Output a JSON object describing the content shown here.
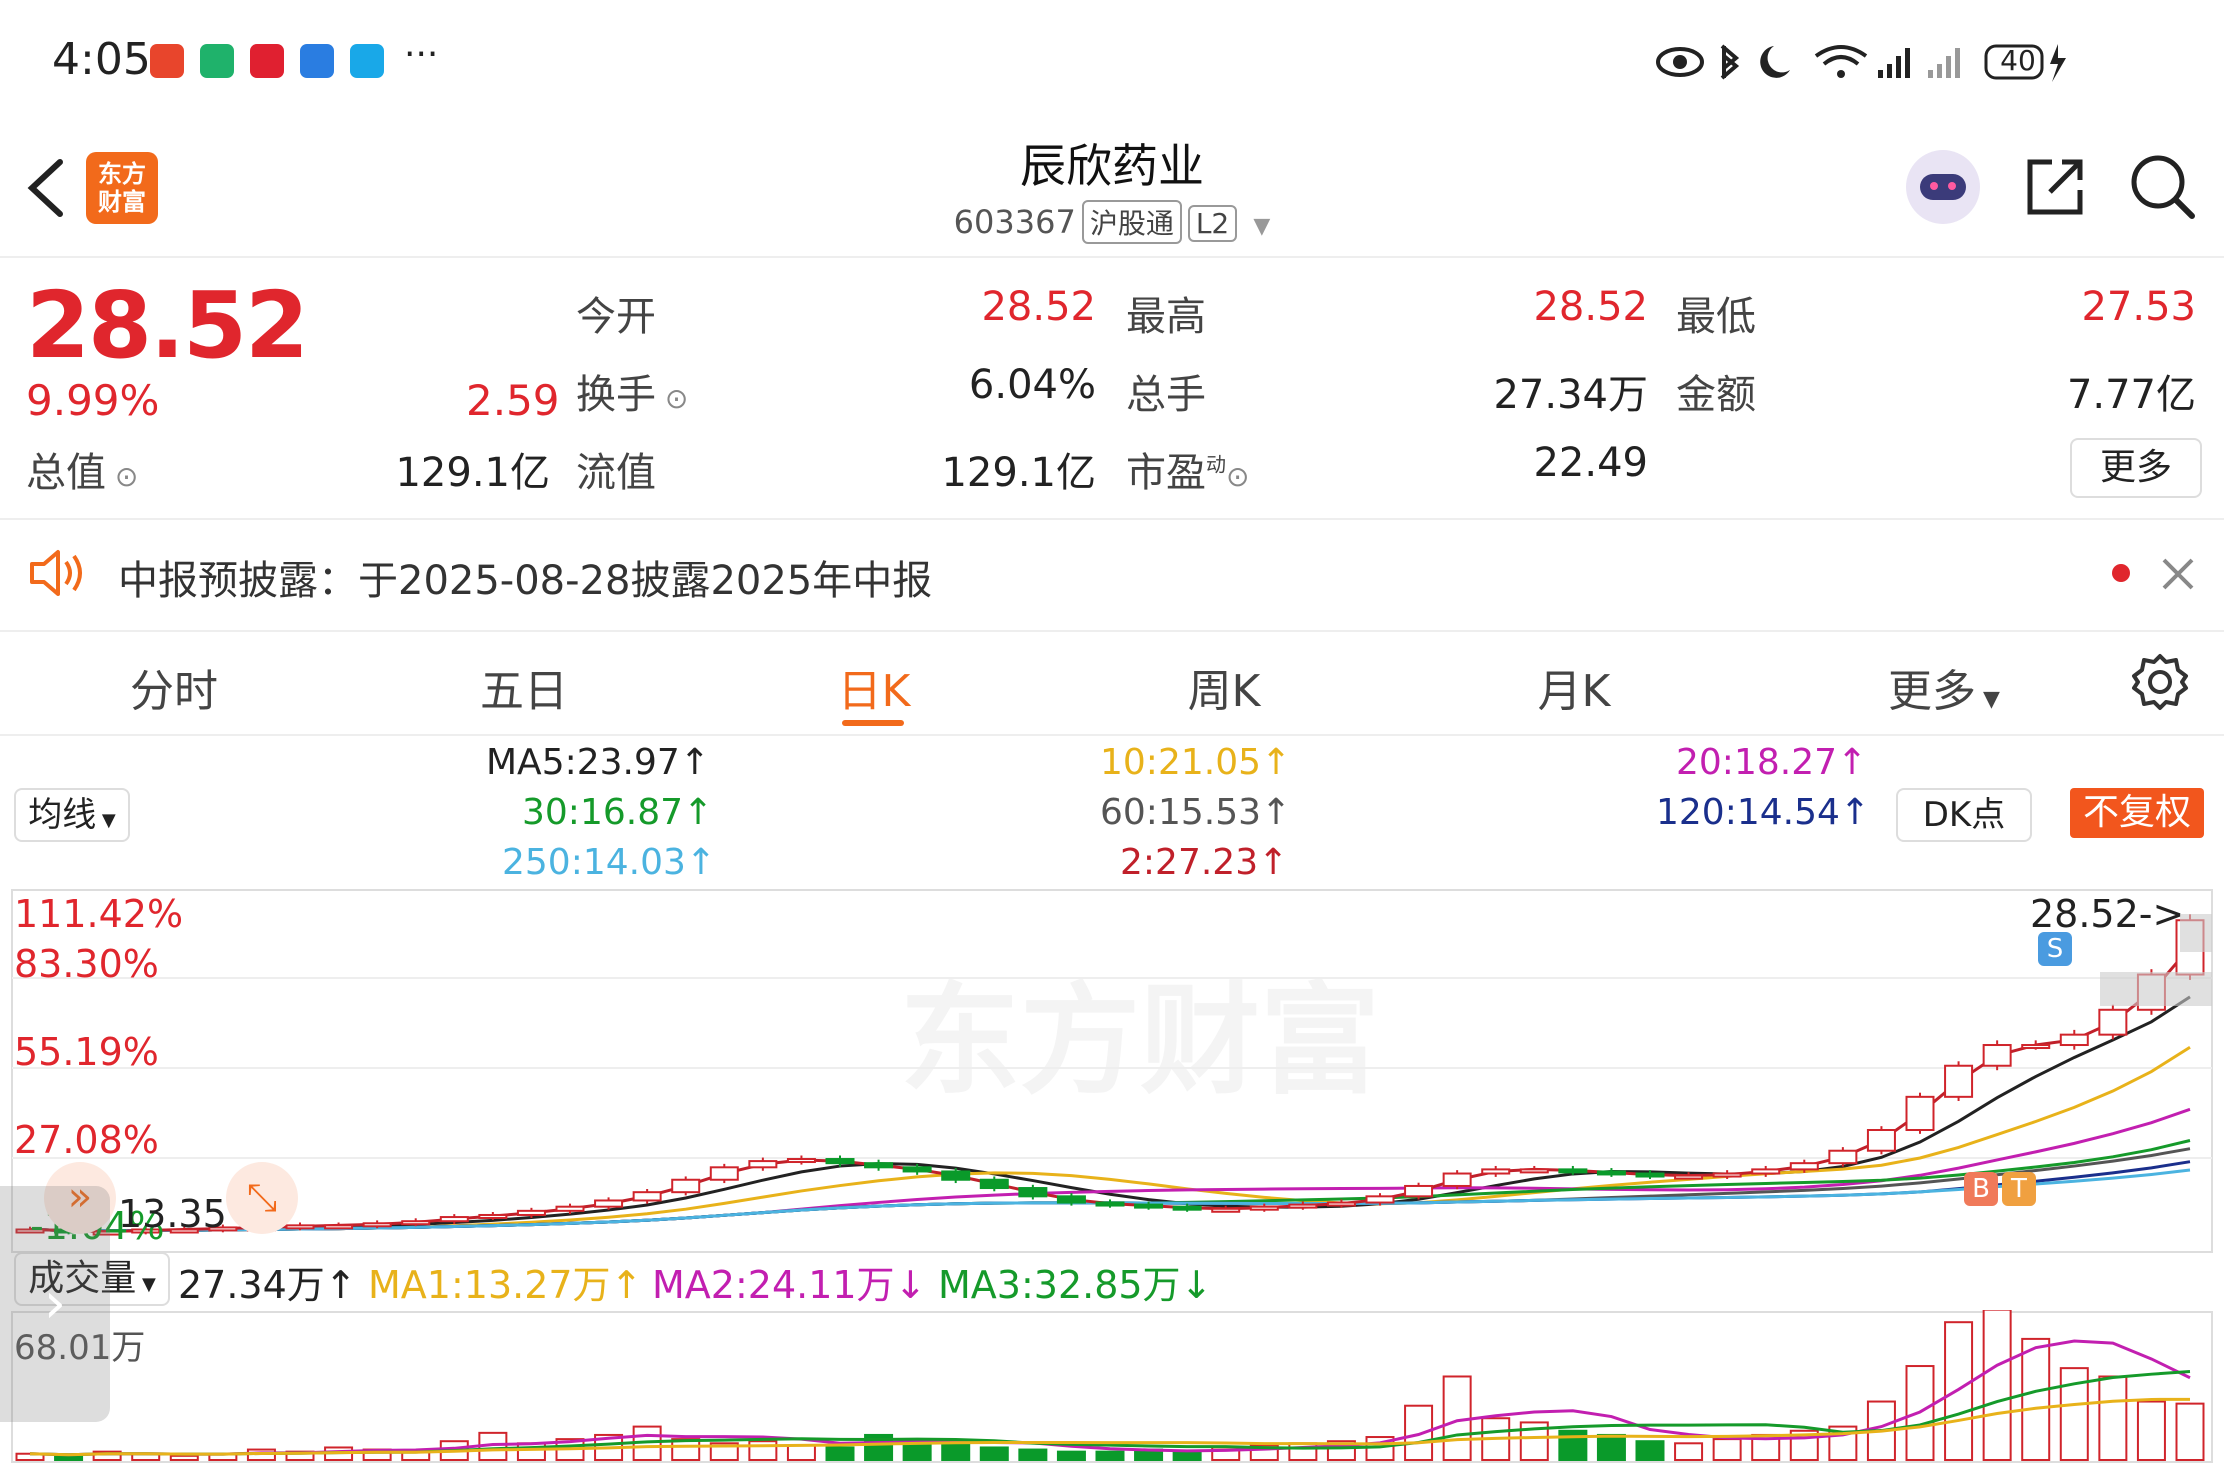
{
  "status_bar": {
    "time": "4:05",
    "ellipsis": "···",
    "battery": "40",
    "app_colors": [
      "#e8452c",
      "#1fb26b",
      "#e02030",
      "#2a7de1",
      "#19a8e8"
    ]
  },
  "header": {
    "logo_line1": "东方",
    "logo_line2": "财富",
    "title": "辰欣药业",
    "code": "603367",
    "tag_connect": "沪股通",
    "tag_level": "L2"
  },
  "quote": {
    "price": "28.52",
    "change_pct": "9.99%",
    "change": "2.59",
    "total_value_label": "总值",
    "total_value": "129.1亿",
    "open_label": "今开",
    "open": "28.52",
    "high_label": "最高",
    "high": "28.52",
    "low_label": "最低",
    "low": "27.53",
    "turnover_label": "换手",
    "turnover": "6.04%",
    "total_hands_label": "总手",
    "total_hands": "27.34万",
    "amount_label": "金额",
    "amount": "7.77亿",
    "float_value_label": "流值",
    "float_value": "129.1亿",
    "pe_label": "市盈",
    "pe_sup": "动",
    "pe": "22.49",
    "more": "更多"
  },
  "notice": {
    "text": "中报预披露：于2025-08-28披露2025年中报"
  },
  "tabs": [
    {
      "label": "分时"
    },
    {
      "label": "五日"
    },
    {
      "label": "日K"
    },
    {
      "label": "周K"
    },
    {
      "label": "月K"
    },
    {
      "label": "更多"
    }
  ],
  "ma_panel": {
    "selector": "均线",
    "ma5": "MA5:23.97↑",
    "ma10": "10:21.05↑",
    "ma20": "20:18.27↑",
    "ma30": "30:16.87↑",
    "ma60": "60:15.53↑",
    "ma120": "120:14.54↑",
    "ma250": "250:14.03↑",
    "ma2": "2:27.23↑",
    "dk": "DK点",
    "adjust": "不复权",
    "colors": {
      "ma5": "#222222",
      "ma10": "#e8b21a",
      "ma20": "#c21fb0",
      "ma30": "#159a2a",
      "ma60": "#555555",
      "ma120": "#1a2f8c",
      "ma250": "#4bb3e0",
      "ma2": "#c0202a"
    }
  },
  "chart_data": {
    "type": "candlestick",
    "price_axis_labels": [
      "111.42%",
      "83.30%",
      "55.19%",
      "27.08%",
      "-1.04%"
    ],
    "last_price_marker": "28.52->",
    "min_price_label": "13.35",
    "signal_marks": [
      "S",
      "B",
      "T"
    ],
    "watermark": "东方财富",
    "close": [
      13.6,
      13.5,
      13.5,
      13.6,
      13.6,
      13.7,
      13.7,
      13.8,
      13.8,
      13.9,
      14.0,
      14.2,
      14.3,
      14.5,
      14.7,
      15.0,
      15.4,
      16.0,
      16.6,
      16.9,
      17.0,
      16.8,
      16.6,
      16.4,
      16.0,
      15.6,
      15.2,
      14.9,
      14.8,
      14.7,
      14.6,
      14.6,
      14.7,
      14.8,
      14.9,
      15.2,
      15.7,
      16.3,
      16.5,
      16.5,
      16.4,
      16.3,
      16.2,
      16.2,
      16.3,
      16.5,
      16.8,
      17.4,
      18.4,
      20.0,
      21.5,
      22.5,
      22.5,
      23.0,
      24.2,
      25.9,
      28.52
    ]
  },
  "volume_panel": {
    "selector": "成交量",
    "vol": "27.34万↑",
    "ma1": "MA1:13.27万↑",
    "ma2": "MA2:24.11万↓",
    "ma3": "MA3:32.85万↓",
    "max_label": "68.01万",
    "volumes_wan": [
      3,
      2,
      4,
      3,
      2,
      3,
      5,
      4,
      6,
      5,
      4,
      9,
      13,
      8,
      10,
      12,
      16,
      10,
      8,
      9,
      7,
      6,
      12,
      10,
      8,
      6,
      5,
      4,
      4,
      5,
      4,
      6,
      7,
      8,
      9,
      11,
      26,
      40,
      20,
      18,
      14,
      12,
      9,
      8,
      10,
      12,
      14,
      16,
      28,
      45,
      66,
      72,
      58,
      44,
      40,
      28,
      27
    ]
  }
}
